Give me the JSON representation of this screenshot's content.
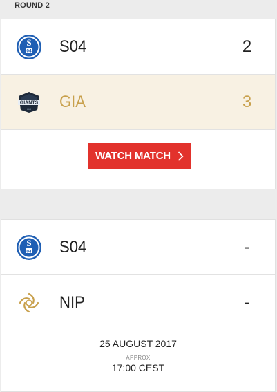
{
  "round": {
    "label": "ROUND 2"
  },
  "matches": [
    {
      "teams": [
        {
          "name": "S04",
          "score": "2",
          "logo_icon": "schalke-04-logo-icon",
          "winner": false
        },
        {
          "name": "GIA",
          "score": "3",
          "logo_icon": "giants-logo-icon",
          "winner": true
        }
      ],
      "watch_label": "WATCH MATCH"
    },
    {
      "teams": [
        {
          "name": "S04",
          "score": "-",
          "logo_icon": "schalke-04-logo-icon",
          "winner": false
        },
        {
          "name": "NIP",
          "score": "-",
          "logo_icon": "ninjas-in-pyjamas-logo-icon",
          "winner": false
        }
      ],
      "schedule": {
        "date": "25 AUGUST 2017",
        "approx": "APPROX",
        "time": "17:00 CEST"
      }
    }
  ],
  "colors": {
    "accent_red": "#e2322c",
    "winner_gold": "#c8a04c",
    "winner_bg": "#f8f1e3"
  }
}
